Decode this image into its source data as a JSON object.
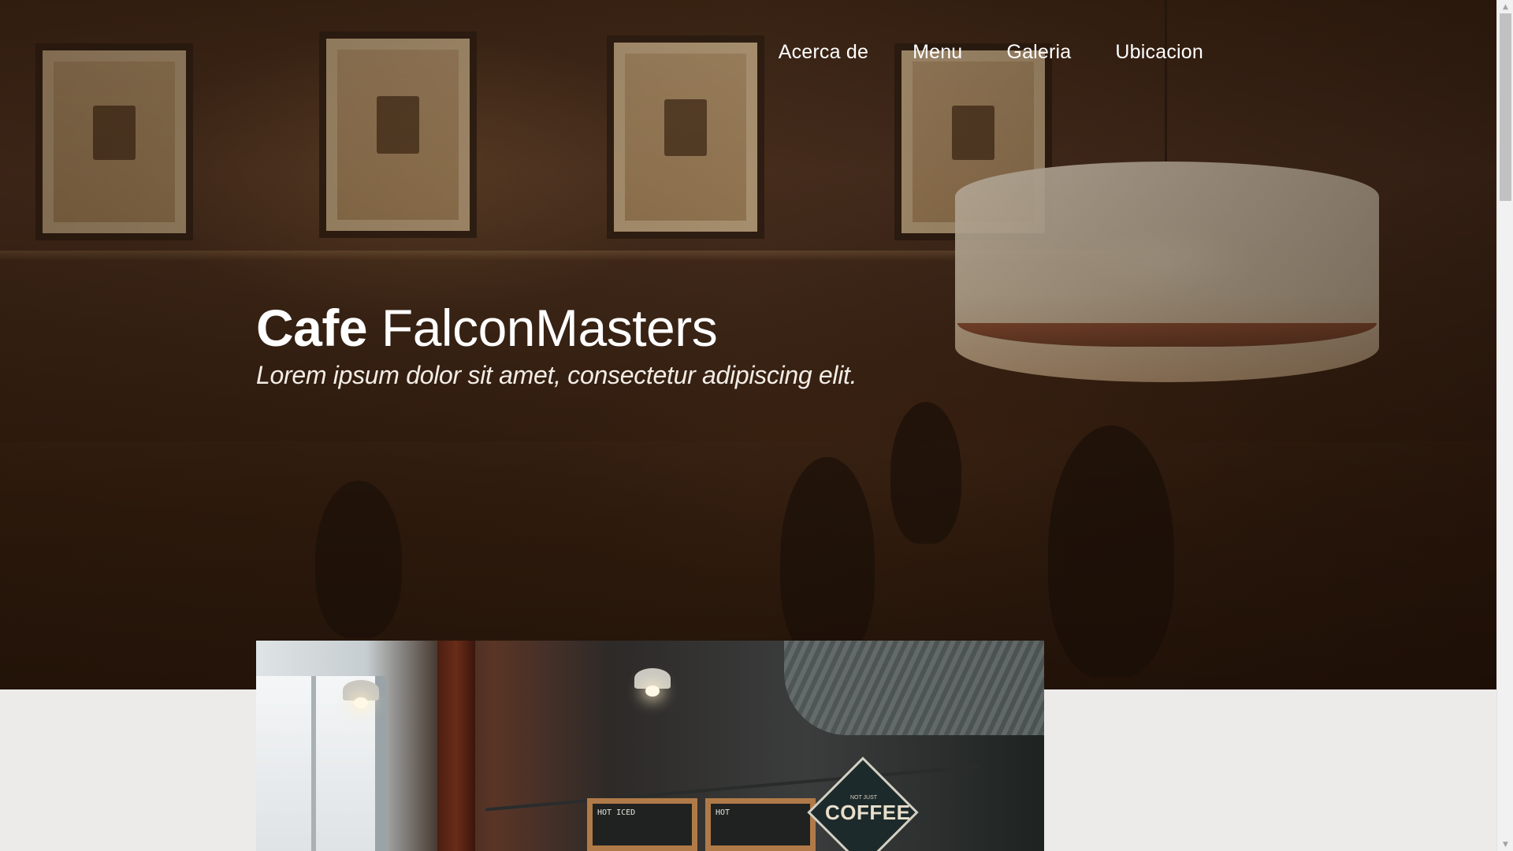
{
  "nav": {
    "items": [
      {
        "label": "Acerca de"
      },
      {
        "label": "Menu"
      },
      {
        "label": "Galeria"
      },
      {
        "label": "Ubicacion"
      }
    ]
  },
  "hero": {
    "title_bold": "Cafe",
    "title_light": "FalconMasters",
    "subtitle": "Lorem ipsum dolor sit amet, consectetur adipiscing elit."
  },
  "photo": {
    "sign_main": "COFFEE",
    "sign_small": "NOT JUST",
    "board_left_label": "HOT   ICED",
    "board_right_label": "HOT"
  },
  "colors": {
    "hero_dark": "#2a1709",
    "page_background": "#ecebea",
    "text_light": "#ffffff"
  }
}
